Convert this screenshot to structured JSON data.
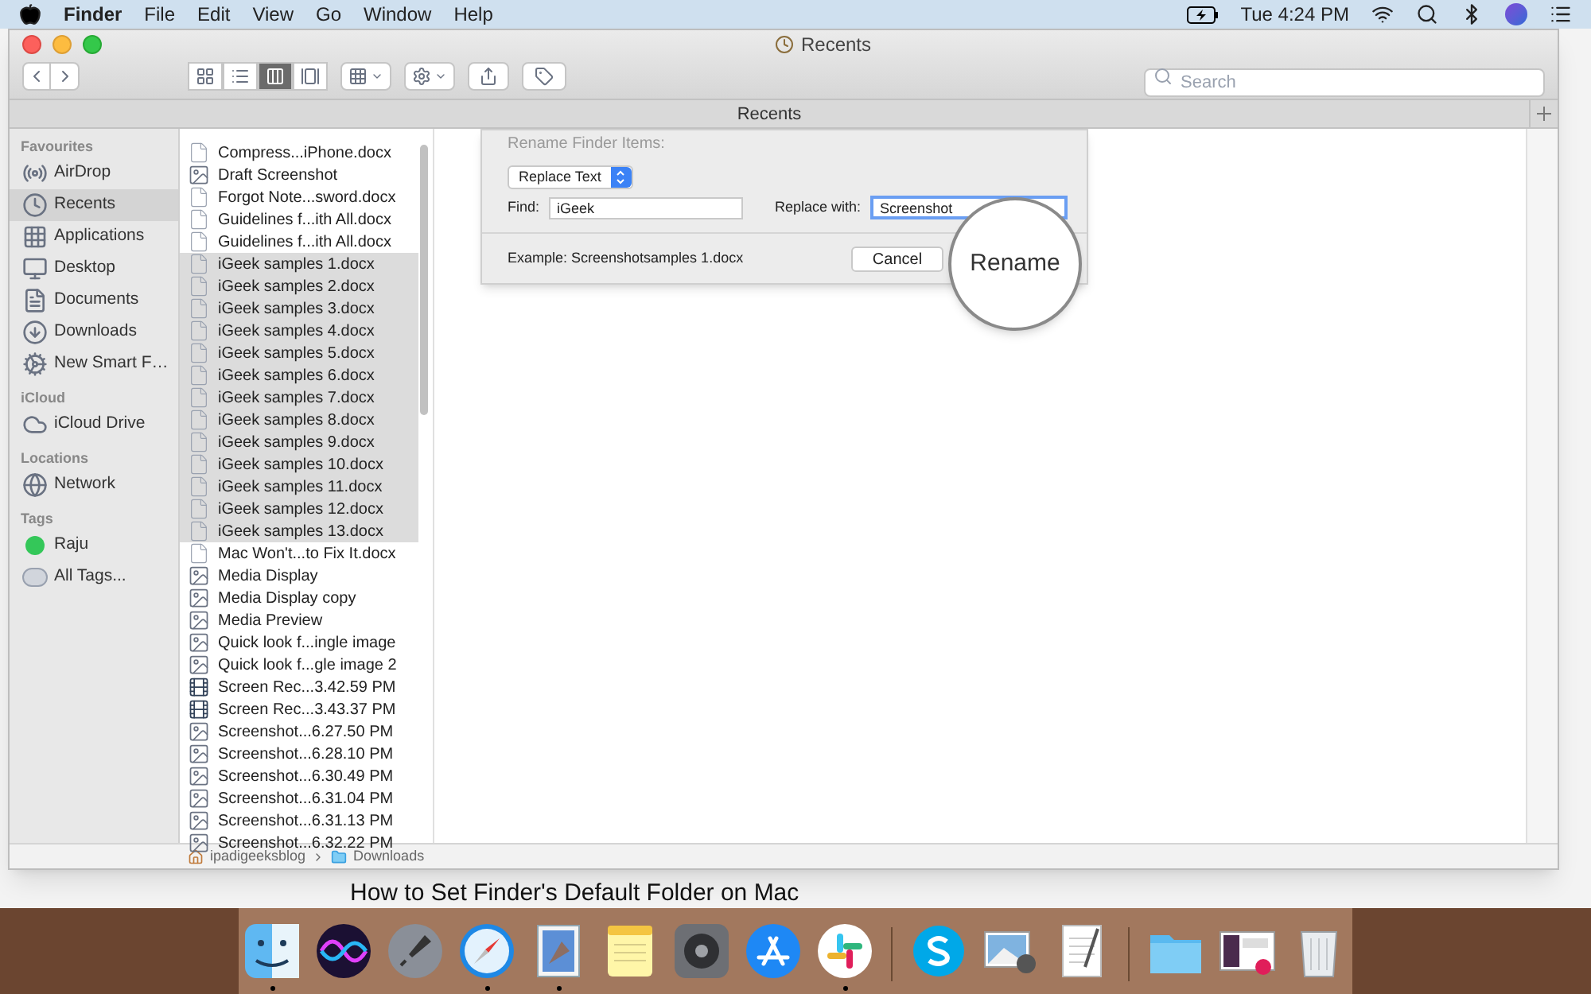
{
  "menu_bar": {
    "items": [
      {
        "label": "Finder",
        "bold": true
      },
      {
        "label": "File",
        "bold": false
      },
      {
        "label": "Edit",
        "bold": false
      },
      {
        "label": "View",
        "bold": false
      },
      {
        "label": "Go",
        "bold": false
      },
      {
        "label": "Window",
        "bold": false
      },
      {
        "label": "Help",
        "bold": false
      }
    ],
    "clock": "Tue 4:24 PM"
  },
  "window": {
    "title": "Recents",
    "tab": "Recents",
    "search": {
      "placeholder": "Search"
    },
    "view_modes": [
      {
        "kind": "icons",
        "selected": false
      },
      {
        "kind": "list",
        "selected": false
      },
      {
        "kind": "columns",
        "selected": true
      },
      {
        "kind": "gallery",
        "selected": false
      }
    ]
  },
  "sidebar": [
    {
      "heading": "Favourites",
      "items": [
        {
          "label": "AirDrop",
          "kind": "airdrop",
          "selected": false
        },
        {
          "label": "Recents",
          "kind": "recents",
          "selected": true
        },
        {
          "label": "Applications",
          "kind": "applications",
          "selected": false
        },
        {
          "label": "Desktop",
          "kind": "desktop",
          "selected": false
        },
        {
          "label": "Documents",
          "kind": "documents",
          "selected": false
        },
        {
          "label": "Downloads",
          "kind": "downloads",
          "selected": false
        },
        {
          "label": "New Smart F…",
          "kind": "smart",
          "selected": false
        }
      ]
    },
    {
      "heading": "iCloud",
      "items": [
        {
          "label": "iCloud Drive",
          "kind": "cloud",
          "selected": false
        }
      ]
    },
    {
      "heading": "Locations",
      "items": [
        {
          "label": "Network",
          "kind": "network",
          "selected": false
        }
      ]
    },
    {
      "heading": "Tags",
      "items": [
        {
          "label": "Raju",
          "kind": "tag",
          "color": "#34c759",
          "selected": false
        },
        {
          "label": "All Tags...",
          "kind": "alltags",
          "selected": false
        }
      ]
    }
  ],
  "files": [
    {
      "name": "Compress...iPhone.docx",
      "kind": "document",
      "selected": false
    },
    {
      "name": "Draft Screenshot",
      "kind": "image",
      "selected": false
    },
    {
      "name": "Forgot Note...sword.docx",
      "kind": "document",
      "selected": false
    },
    {
      "name": "Guidelines f...ith All.docx",
      "kind": "document",
      "selected": false
    },
    {
      "name": "Guidelines f...ith All.docx",
      "kind": "document",
      "selected": false
    },
    {
      "name": "iGeek samples 1.docx",
      "kind": "document",
      "selected": true
    },
    {
      "name": "iGeek samples 2.docx",
      "kind": "document",
      "selected": true
    },
    {
      "name": "iGeek samples 3.docx",
      "kind": "document",
      "selected": true
    },
    {
      "name": "iGeek samples 4.docx",
      "kind": "document",
      "selected": true
    },
    {
      "name": "iGeek samples 5.docx",
      "kind": "document",
      "selected": true
    },
    {
      "name": "iGeek samples 6.docx",
      "kind": "document",
      "selected": true
    },
    {
      "name": "iGeek samples 7.docx",
      "kind": "document",
      "selected": true
    },
    {
      "name": "iGeek samples 8.docx",
      "kind": "document",
      "selected": true
    },
    {
      "name": "iGeek samples 9.docx",
      "kind": "document",
      "selected": true
    },
    {
      "name": "iGeek samples 10.docx",
      "kind": "document",
      "selected": true
    },
    {
      "name": "iGeek samples 11.docx",
      "kind": "document",
      "selected": true
    },
    {
      "name": "iGeek samples 12.docx",
      "kind": "document",
      "selected": true
    },
    {
      "name": "iGeek samples 13.docx",
      "kind": "document",
      "selected": true
    },
    {
      "name": "Mac Won't...to Fix It.docx",
      "kind": "document",
      "selected": false
    },
    {
      "name": "Media Display",
      "kind": "image",
      "selected": false
    },
    {
      "name": "Media Display copy",
      "kind": "image",
      "selected": false
    },
    {
      "name": "Media Preview",
      "kind": "image",
      "selected": false
    },
    {
      "name": "Quick look f...ingle image",
      "kind": "image",
      "selected": false
    },
    {
      "name": "Quick look f...gle image 2",
      "kind": "image",
      "selected": false
    },
    {
      "name": "Screen Rec...3.42.59 PM",
      "kind": "recording",
      "selected": false
    },
    {
      "name": "Screen Rec...3.43.37 PM",
      "kind": "recording",
      "selected": false
    },
    {
      "name": "Screenshot...6.27.50 PM",
      "kind": "image",
      "selected": false
    },
    {
      "name": "Screenshot...6.28.10 PM",
      "kind": "image",
      "selected": false
    },
    {
      "name": "Screenshot...6.30.49 PM",
      "kind": "image",
      "selected": false
    },
    {
      "name": "Screenshot...6.31.04 PM",
      "kind": "image",
      "selected": false
    },
    {
      "name": "Screenshot...6.31.13 PM",
      "kind": "image",
      "selected": false
    },
    {
      "name": "Screenshot...6.32.22 PM",
      "kind": "image",
      "selected": false
    }
  ],
  "path_bar": [
    "ipadigeeksblog",
    "Downloads"
  ],
  "rename_dialog": {
    "title": "Rename Finder Items:",
    "mode": "Replace Text",
    "find_label": "Find:",
    "find_value": "iGeek",
    "replace_label": "Replace with:",
    "replace_value": "Screenshot",
    "example": "Example: Screenshotsamples 1.docx",
    "cancel": "Cancel",
    "rename": "Rename"
  },
  "page_heading": "How to Set Finder's Default Folder on Mac",
  "dock": [
    {
      "kind": "finder",
      "running": true
    },
    {
      "kind": "siri",
      "running": false
    },
    {
      "kind": "launchpad",
      "running": false
    },
    {
      "kind": "safari",
      "running": true
    },
    {
      "kind": "mail",
      "running": true
    },
    {
      "kind": "notes",
      "running": false
    },
    {
      "kind": "settings",
      "running": false
    },
    {
      "kind": "appstore",
      "running": false
    },
    {
      "kind": "slack",
      "running": true
    },
    {
      "kind": "separator"
    },
    {
      "kind": "skype",
      "running": false
    },
    {
      "kind": "preview",
      "running": false
    },
    {
      "kind": "textedit",
      "running": false
    },
    {
      "kind": "separator"
    },
    {
      "kind": "folder",
      "running": false
    },
    {
      "kind": "stack",
      "running": false
    },
    {
      "kind": "trash",
      "running": false
    }
  ]
}
